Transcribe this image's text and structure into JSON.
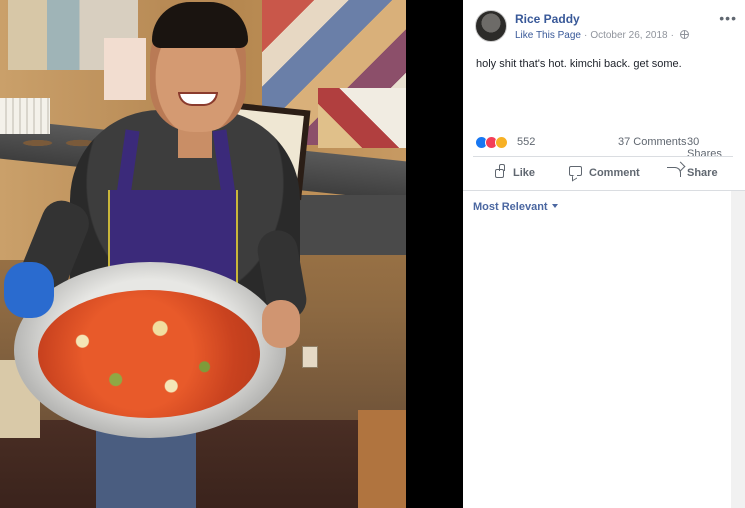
{
  "post": {
    "page_name": "Rice Paddy",
    "like_page_label": "Like This Page",
    "date": "October 26, 2018",
    "separator": "·",
    "more_label": "•••",
    "text": "holy shit that's hot. kimchi back. get some."
  },
  "reactions": {
    "count": "552",
    "comments": "37 Comments",
    "shares": "30 Shares"
  },
  "actions": {
    "like": "Like",
    "comment": "Comment",
    "share": "Share"
  },
  "comments": {
    "sort_label": "Most Relevant"
  },
  "colors": {
    "link": "#385898",
    "like_reaction": "#1877f2",
    "love_reaction": "#f33e58",
    "haha_reaction": "#f7b125"
  }
}
